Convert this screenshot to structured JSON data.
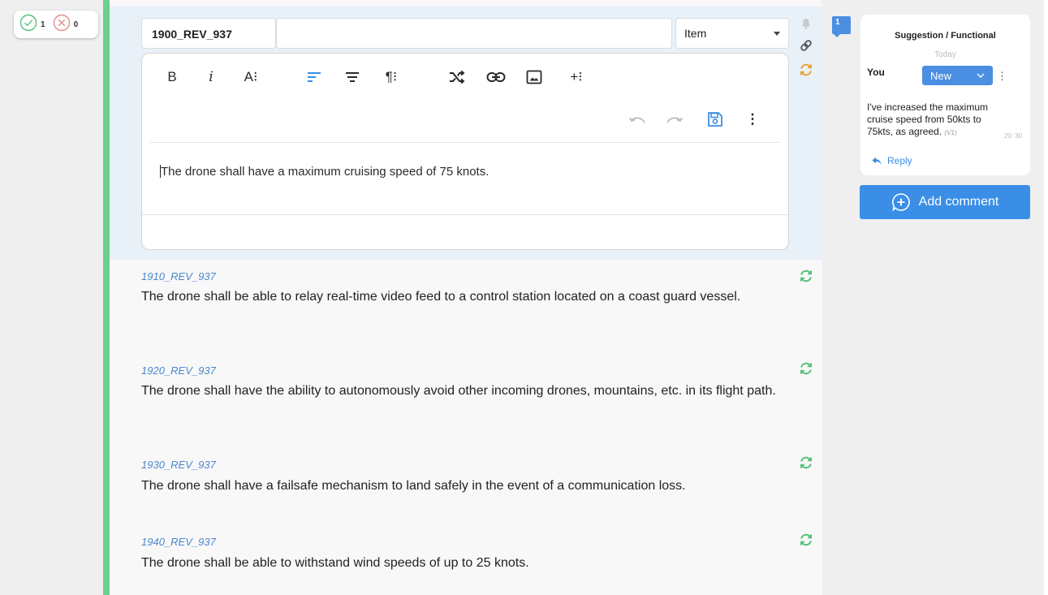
{
  "status_counts": {
    "approved": "1",
    "rejected": "0"
  },
  "active_item": {
    "id": "1900_REV_937",
    "name_value": "",
    "type_select": "Item",
    "body_text": "The drone shall have a maximum cruising speed of 75 knots."
  },
  "toolbar": {
    "bold": "B",
    "italic": "i",
    "font_size": "A⁝",
    "align_left": "≡",
    "align_center": "≡",
    "paragraph": "¶⁝",
    "insert_more": "+⁝",
    "more": "⋮"
  },
  "requirements": [
    {
      "id": "1910_REV_937",
      "text": "The drone shall be able to relay real-time video feed to a control station located on a coast guard vessel."
    },
    {
      "id": "1920_REV_937",
      "text": "The drone shall have the ability to autonomously avoid other incoming drones, mountains, etc. in its flight path."
    },
    {
      "id": "1930_REV_937",
      "text": "The drone shall have a failsafe mechanism to land safely in the event of a communication loss."
    },
    {
      "id": "1940_REV_937",
      "text": "The drone shall be able to withstand wind speeds of up to 25 knots."
    }
  ],
  "comments": {
    "count": "1",
    "card": {
      "title": "Suggestion / Functional",
      "date_label": "Today",
      "author": "You",
      "status": "New",
      "kebab": "⋮",
      "body": "I've increased the maximum cruise speed from 50kts to 75kts, as agreed.",
      "version": "(V1)",
      "time": "20: 30",
      "reply_label": "Reply"
    },
    "add_label": "Add comment"
  },
  "colors": {
    "accent": "#3a8ee6",
    "status_bar": "#6ccf8e",
    "sync_green": "#52c07a",
    "sync_orange": "#f0a030",
    "approved": "#52c07a",
    "rejected": "#e58b8b"
  }
}
